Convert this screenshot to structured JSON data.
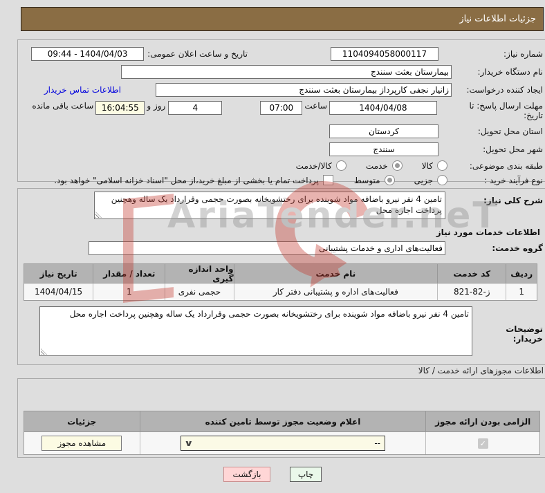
{
  "titlebar": {
    "title": "جزئیات اطلاعات نیاز"
  },
  "form": {
    "need_number": {
      "label": "شماره نیاز:",
      "value": "1104094058000117"
    },
    "announce": {
      "label": "تاریخ و ساعت اعلان عمومی:",
      "value": "1404/04/03 - 09:44"
    },
    "buyer_org": {
      "label": "نام دستگاه خریدار:",
      "value": "بیمارستان بعثت سنندج"
    },
    "creator": {
      "label": "ایجاد کننده درخواست:",
      "value": "زانیار نجفی کارپرداز بیمارستان بعثت سنندج",
      "contact_link": "اطلاعات تماس خریدار"
    },
    "deadline": {
      "label": "مهلت ارسال پاسخ: تا تاریخ:",
      "date": "1404/04/08",
      "hour_label": "ساعت",
      "time": "07:00",
      "days": "4",
      "days_label": "روز و",
      "countdown": "16:04:55",
      "remaining_label": "ساعت باقی مانده"
    },
    "province": {
      "label": "استان محل تحویل:",
      "value": "کردستان"
    },
    "city": {
      "label": "شهر محل تحویل:",
      "value": "سنندج"
    },
    "subject_class": {
      "label": "طبقه بندی موضوعی:",
      "options": [
        {
          "label": "کالا",
          "selected": false
        },
        {
          "label": "خدمت",
          "selected": true
        },
        {
          "label": "کالا/خدمت",
          "selected": false
        }
      ]
    },
    "process_type": {
      "label": "نوع فرآیند خرید :",
      "options": [
        {
          "label": "جزیی",
          "selected": false
        },
        {
          "label": "متوسط",
          "selected": true
        }
      ],
      "treasury_label": "پرداخت تمام یا بخشی از مبلغ خرید،از محل \"اسناد خزانه اسلامی\" خواهد بود.",
      "treasury_checked": false
    }
  },
  "need_desc": {
    "label": "شرح کلی نیاز:",
    "value": "تامین 4 نفر نیرو باضافه مواد شوینده برای رختشویخانه بصورت حجمی وقرارداد یک ساله وهچنین پرداخت اجاره محل"
  },
  "services": {
    "title": "اطلاعات خدمات مورد نیاز",
    "group": {
      "label": "گروه خدمت:",
      "value": "فعالیت‌های اداری و خدمات پشتیبانی"
    },
    "table": {
      "headers": [
        "ردیف",
        "کد خدمت",
        "نام خدمت",
        "واحد اندازه گیری",
        "تعداد / مقدار",
        "تاریخ نیاز"
      ],
      "rows": [
        [
          "1",
          "ز-82-821",
          "فعالیت‌های اداره و پشتیبانی دفتر کار",
          "حجمی نفری",
          "1",
          "1404/04/15"
        ]
      ]
    },
    "notes": {
      "label": "توضیحات خریدار:",
      "value": "تامین 4 نفر نیرو باضافه مواد شوینده برای رختشویخانه بصورت حجمی وقرارداد یک ساله وهچنین پرداخت اجاره محل"
    }
  },
  "licenses": {
    "title": "اطلاعات مجوزهای ارائه خدمت / کالا",
    "table": {
      "headers": [
        "الزامی بودن ارائه مجوز",
        "اعلام وضعیت مجوز توسط تامین کننده",
        "جزئیات"
      ],
      "row": {
        "required_checked": true,
        "status_value": "--",
        "details_button": "مشاهده مجوز"
      }
    }
  },
  "footer": {
    "back": "بازگشت",
    "print": "چاپ"
  },
  "watermark": {
    "text": "AriaTender.neT"
  },
  "colors": {
    "titlebar_bg": "#8a6d44",
    "countdown_bg": "#fcfbe3",
    "back_bg": "#ffd6d6",
    "print_bg": "#eaf8ea",
    "link": "#0000dd",
    "table_header_bg": "#b3b3b3",
    "button_yellow_bg": "#fcfbe3"
  }
}
